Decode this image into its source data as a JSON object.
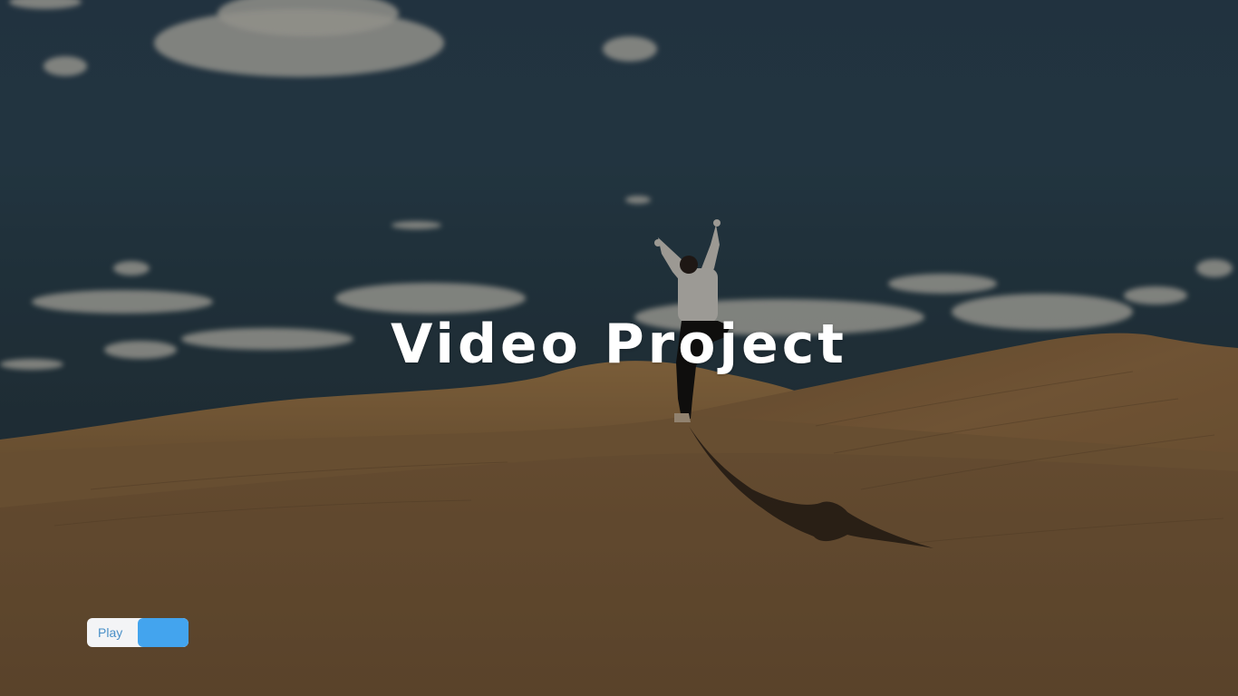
{
  "app": {
    "title": "Video Project"
  },
  "controls": {
    "play_toggle": {
      "label": "Play",
      "state": "off"
    }
  },
  "colors": {
    "title_text": "#ffffff",
    "toggle_track": "#f3f4f6",
    "toggle_knob": "#43a4ee",
    "toggle_label": "#4a90c8"
  },
  "background": {
    "icon": "desert-video-frame"
  }
}
